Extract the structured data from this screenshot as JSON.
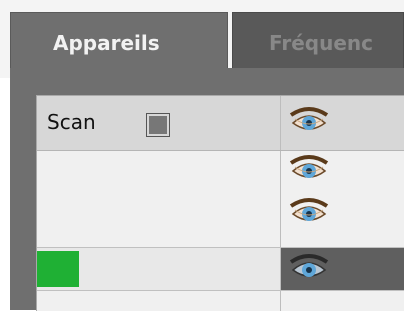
{
  "tabs": [
    {
      "label": "Appareils",
      "active": true
    },
    {
      "label": "Fréquenc",
      "active": false
    }
  ],
  "table": {
    "header": {
      "scan_label": "Scan",
      "scan_checked": false
    },
    "rows_icons": [
      "eye-icon",
      "eye-icon",
      "eye-icon",
      "eye-icon"
    ],
    "progress": {
      "fraction": 0.17,
      "color": "#1fb034"
    }
  },
  "colors": {
    "tab_active_bg": "#6f6f6f",
    "tab_inactive_bg": "#595959",
    "selected_cell_bg": "#5f5f5f",
    "accent_green": "#1fb034"
  }
}
